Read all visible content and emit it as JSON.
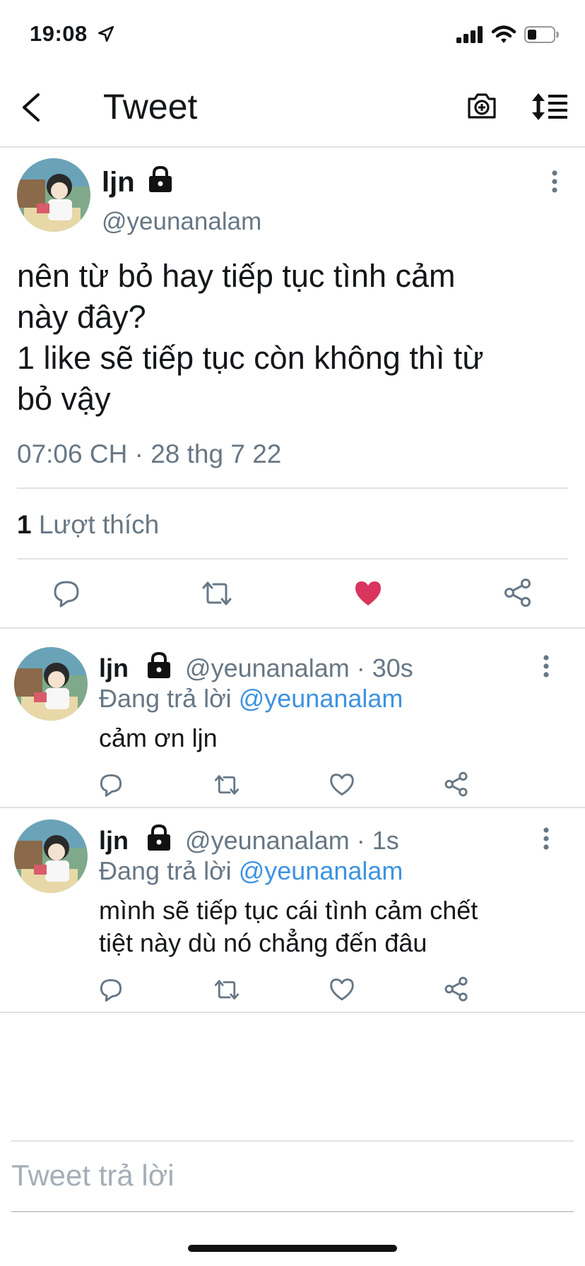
{
  "status_bar": {
    "time": "19:08"
  },
  "nav": {
    "title": "Tweet"
  },
  "tweet": {
    "author_name": "ljn",
    "handle": "@yeunanalam",
    "text": "nên từ bỏ hay tiếp tục tình cảm\nnày đây?\n1 like sẽ tiếp tục còn không thì từ\nbỏ vậy",
    "timestamp": "07:06 CH · 28 thg 7 22",
    "like_count": "1",
    "like_label": "Lượt thích"
  },
  "replies": [
    {
      "author_name": "ljn",
      "meta": "@yeunanalam · 30s",
      "replying_prefix": "Đang trả lời",
      "replying_to": "@yeunanalam",
      "text": "cảm ơn ljn"
    },
    {
      "author_name": "ljn",
      "meta": "@yeunanalam · 1s",
      "replying_prefix": "Đang trả lời",
      "replying_to": "@yeunanalam",
      "text": "mình sẽ tiếp tục cái tình cảm chết\ntiệt này dù nó chẳng đến đâu"
    }
  ],
  "compose": {
    "placeholder": "Tweet trả lời"
  },
  "colors": {
    "like_active": "#d9355e",
    "link": "#3d93e0",
    "muted": "#677785"
  }
}
